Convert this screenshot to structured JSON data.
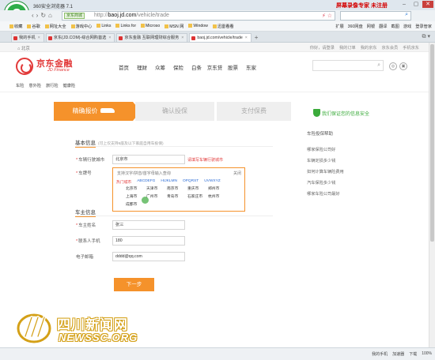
{
  "browser": {
    "app_title": "360安全浏览器 7.1",
    "brand_right": "屏幕录像专家 未注册",
    "url_secure_tag": "京东商城",
    "url_prefix": "http://",
    "url_host": "baoj.jd.com",
    "url_path": "/vehicle/trade",
    "favorites": [
      "收藏",
      "谷歌",
      "网址大全",
      "游戏中心",
      "Links",
      "Links for",
      "Microso",
      "MSN 网",
      "Window",
      "迅雷看看"
    ],
    "fav_right": [
      "扩展",
      "360网盘",
      "网银",
      "翻译",
      "截图",
      "游戏",
      "登录管家"
    ],
    "tabs": [
      {
        "label": "我的手机",
        "active": false
      },
      {
        "label": "京东(JD.COM)-综合网购首选",
        "active": false
      },
      {
        "label": "京东金融 互联网理财综合服务",
        "active": false
      },
      {
        "label": "baoj.jd.com/vehicle/trade",
        "active": true
      }
    ]
  },
  "site": {
    "location": "北京",
    "top_links": [
      "你好，请登录",
      "我的订单",
      "我的京东",
      "京东会员",
      "手机京东"
    ],
    "logo_cn": "京东金融",
    "logo_en": "JD Finance",
    "nav": [
      "首页",
      "理财",
      "众筹",
      "保险",
      "白条",
      "京东贷",
      "股票",
      "东家"
    ],
    "sub_nav": [
      "车险",
      "意外险",
      "旅行险",
      "健康险"
    ]
  },
  "steps": [
    "精确报价",
    "确认投保",
    "支付保费"
  ],
  "basic_info": {
    "title": "基本信息",
    "note": "(可上仅支持6座及以下家庭自用车投保)",
    "city_label": "车辆行驶城市",
    "city_value": "北京市",
    "city_hint": "请填写车辆行驶城市",
    "plate_label": "车牌号",
    "plate_placeholder": "支持汉字/拼音/首字母输入查询",
    "plate_close": "关闭",
    "plate_tabs": [
      "热门城市",
      "ABCDEFG",
      "HIJKLMN",
      "OPQRST",
      "UVWXYZ"
    ],
    "cities": [
      "北京市",
      "天津市",
      "南京市",
      "重庆市",
      "郑州市",
      "上海市",
      "广州市",
      "青岛市",
      "石家庄市",
      "杭州市",
      "成都市"
    ]
  },
  "owner_info": {
    "title": "车主信息",
    "name_label": "车主姓名",
    "name_value": "张三",
    "phone_label": "联系人手机",
    "phone_value": "180",
    "email_label": "电子邮箱",
    "email_value": "dddd@qq.com"
  },
  "next_button": "下一步",
  "right_panel": {
    "safe_text": "我们保证您的信息安全",
    "help_title": "车险投保帮助",
    "help_items": [
      "哪家保险公司好",
      "车辆定损多少钱",
      "如何计算车辆险费用",
      "汽车保险多少钱",
      "哪家车险公司最好"
    ]
  },
  "watermark": {
    "text_cn": "四川新闻网",
    "text_en": "NEWSSC.ORG"
  },
  "statusbar": [
    "我的手机",
    "加速器",
    "下载",
    "100%"
  ]
}
